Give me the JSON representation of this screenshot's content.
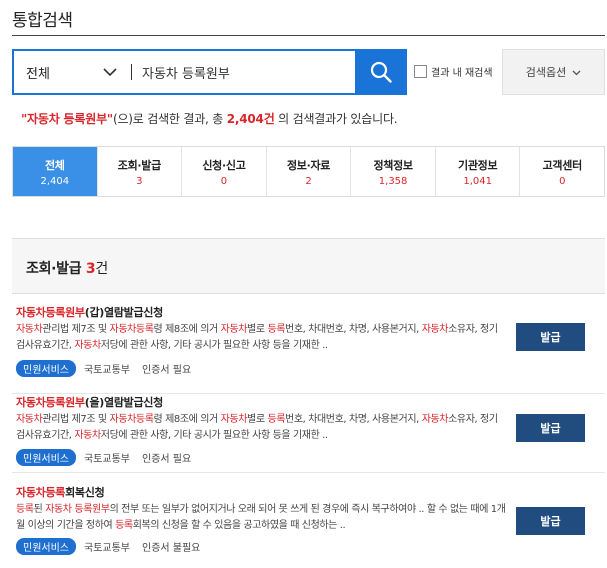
{
  "page": {
    "title": "통합검색"
  },
  "search": {
    "scope": "전체",
    "query": "자동차 등록원부",
    "research_label": "결과 내 재검색",
    "options_label": "검색옵션"
  },
  "summary": {
    "query": "\"자동차 등록원부\"",
    "text_a": "(으)로 검색한 결과, 총 ",
    "total": "2,404",
    "unit": "건",
    "text_b": " 의 검색결과가 있습니다."
  },
  "tabs": [
    {
      "label": "전체",
      "count": "2,404",
      "active": true
    },
    {
      "label": "조회·발급",
      "count": "3"
    },
    {
      "label": "신청·신고",
      "count": "0"
    },
    {
      "label": "정보·자료",
      "count": "2"
    },
    {
      "label": "정책정보",
      "count": "1,358"
    },
    {
      "label": "기관정보",
      "count": "1,041"
    },
    {
      "label": "고객센터",
      "count": "0"
    }
  ],
  "section": {
    "title": "조회·발급",
    "count": "3",
    "unit": "건"
  },
  "results": [
    {
      "title_hl": "자동차등록원부",
      "title_rest": "(갑)열람발급신청",
      "desc": [
        {
          "t": "자동차",
          "h": true
        },
        {
          "t": "관리법 제7조 및 "
        },
        {
          "t": "자동차등록",
          "h": true
        },
        {
          "t": "령 제8조에 의거 "
        },
        {
          "t": "자동차",
          "h": true
        },
        {
          "t": "별로 "
        },
        {
          "t": "등록",
          "h": true
        },
        {
          "t": "번호, 차대번호, 차명, 사용본거지, "
        },
        {
          "t": "자동차",
          "h": true
        },
        {
          "t": "소유자, 정기검사유효기간, "
        },
        {
          "t": "자동차",
          "h": true
        },
        {
          "t": "저당에 관한 사항, 기타 공시가 필요한 사항 등을 기재한 .."
        }
      ],
      "badge": "민원서비스",
      "org": "국토교통부",
      "cert": "인증서 필요",
      "button": "발급"
    },
    {
      "title_hl": "자동차등록원부",
      "title_rest": "(을)열람발급신청",
      "desc": [
        {
          "t": "자동차",
          "h": true
        },
        {
          "t": "관리법 제7조 및 "
        },
        {
          "t": "자동차등록",
          "h": true
        },
        {
          "t": "령 제8조에 의거 "
        },
        {
          "t": "자동차",
          "h": true
        },
        {
          "t": "별로 "
        },
        {
          "t": "등록",
          "h": true
        },
        {
          "t": "번호, 차대번호, 차명, 사용본거지, "
        },
        {
          "t": "자동차",
          "h": true
        },
        {
          "t": "소유자, 정기검사유효기간, "
        },
        {
          "t": "자동차",
          "h": true
        },
        {
          "t": "저당에 관한 사항, 기타 공시가 필요한 사항 등을 기재한 .."
        }
      ],
      "badge": "민원서비스",
      "org": "국토교통부",
      "cert": "인증서 필요",
      "button": "발급"
    },
    {
      "title_hl": "자동차등록",
      "title_rest": "회복신청",
      "desc": [
        {
          "t": "등록",
          "h": true
        },
        {
          "t": "된 "
        },
        {
          "t": "자동차",
          "h": true
        },
        {
          "t": " "
        },
        {
          "t": "등록원부",
          "h": true
        },
        {
          "t": "의 전부 또는 일부가 없어지거나 오래 되어 못 쓰게 된 경우에 즉시 복구하여야 .. 할 수 없는 때에 1개월 이상의 기간을 정하여 "
        },
        {
          "t": "등록",
          "h": true
        },
        {
          "t": "회복의 신청을 할 수 있음을 공고하였을 때 신청하는 .."
        }
      ],
      "badge": "민원서비스",
      "org": "국토교통부",
      "cert": "인증서 불필요",
      "button": "발급"
    }
  ]
}
